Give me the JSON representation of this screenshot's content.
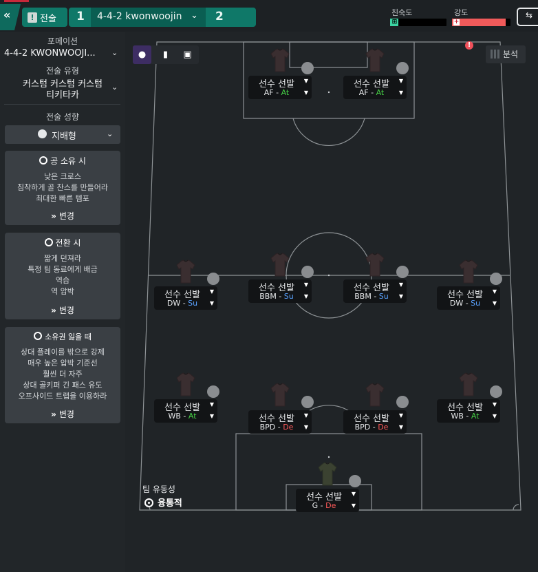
{
  "topbar": {
    "collapse_glyph": "«",
    "tab_label": "전술",
    "tab_icon": "clipboard-icon",
    "tactic_left_number": "1",
    "tactic_selected": "4-4-2 kwonwoojin",
    "tactic_right_number": "2",
    "familiarity_label": "친숙도",
    "intensity_label": "강도",
    "familiarity_fraction": 0.02,
    "intensity_fraction": 0.92,
    "colors": {
      "accent": "#0f7868",
      "familiarity": "#3bd4a2",
      "intensity": "#f05a5a"
    }
  },
  "sidebar": {
    "formation_label": "포메이션",
    "formation_value": "4-4-2 KWONWOOJI...",
    "style_label": "전술 유형",
    "style_value_line1": "커스텀 커스텀 커스텀",
    "style_value_line2": "티키타카",
    "mentality_label": "전술 성향",
    "mentality_value": "지배형",
    "in_possession": {
      "title": "공 소유 시",
      "lines": [
        "낮은 크로스",
        "침착하게 골 찬스를 만들어라",
        "최대한 빠른 템포"
      ],
      "change": "변경"
    },
    "in_transition": {
      "title": "전환 시",
      "lines": [
        "짧게 던져라",
        "특정 팀 동료에게 배급",
        "역습",
        "역 압박"
      ],
      "change": "변경"
    },
    "out_of_possession": {
      "title": "소유권 잃을 때",
      "lines": [
        "상대 플레이를 밖으로 강제",
        "매우 높은 압박 기준선",
        "훨씬 더 자주",
        "상대 골키퍼 긴 패스 유도",
        "오프사이드 트랩을 이용하라"
      ],
      "change": "변경"
    }
  },
  "toolbar": {
    "analysis_label": "분석",
    "warning_glyph": "!"
  },
  "players": [
    {
      "id": "af-left",
      "select": "선수 선발",
      "role": "AF",
      "duty": "At"
    },
    {
      "id": "af-right",
      "select": "선수 선발",
      "role": "AF",
      "duty": "At"
    },
    {
      "id": "dw-left",
      "select": "선수 선발",
      "role": "DW",
      "duty": "Su"
    },
    {
      "id": "bbm-left",
      "select": "선수 선발",
      "role": "BBM",
      "duty": "Su"
    },
    {
      "id": "bbm-right",
      "select": "선수 선발",
      "role": "BBM",
      "duty": "Su"
    },
    {
      "id": "dw-right",
      "select": "선수 선발",
      "role": "DW",
      "duty": "Su"
    },
    {
      "id": "wb-left",
      "select": "선수 선발",
      "role": "WB",
      "duty": "At"
    },
    {
      "id": "bpd-left",
      "select": "선수 선발",
      "role": "BPD",
      "duty": "De"
    },
    {
      "id": "bpd-right",
      "select": "선수 선발",
      "role": "BPD",
      "duty": "De"
    },
    {
      "id": "wb-right",
      "select": "선수 선발",
      "role": "WB",
      "duty": "At"
    },
    {
      "id": "gk",
      "select": "선수 선발",
      "role": "G",
      "duty": "De"
    }
  ],
  "team_fluidity": {
    "label": "팀 유동성",
    "value": "융통적"
  }
}
